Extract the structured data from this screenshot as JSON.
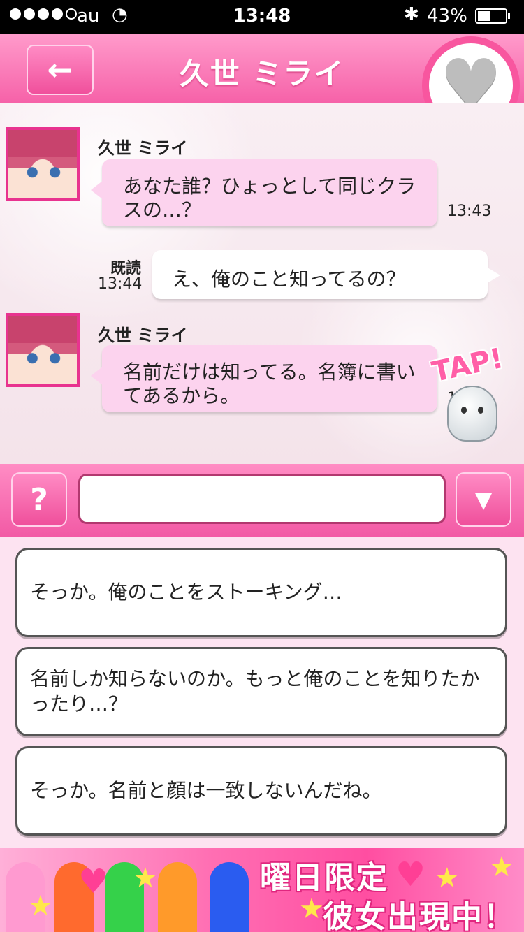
{
  "status_bar": {
    "carrier": "au",
    "time": "13:48",
    "battery_percent": "43%",
    "battery_level": 0.43,
    "signal_bars": 4
  },
  "header": {
    "back_icon": "←",
    "title": "久世 ミライ",
    "heart_icon": "♥"
  },
  "messages": [
    {
      "sender": "久世 ミライ",
      "text": "あなた誰？ひょっとして同じクラスの…？",
      "time": "13:43"
    },
    {
      "read_label": "既読",
      "text": "え、俺のこと知ってるの？",
      "time": "13:44"
    },
    {
      "sender": "久世 ミライ",
      "text": "名前だけは知ってる。名簿に書いてあるから。",
      "time": "13"
    }
  ],
  "tap_label": "TAP!",
  "input_bar": {
    "help_label": "?",
    "input_value": "",
    "dropdown_icon": "▼"
  },
  "choices": [
    "そっか。俺のことをストーキング…",
    "名前しか知らないのか。もっと俺のことを知りたかったり…？",
    "そっか。名前と顔は一致しないんだね。"
  ],
  "banner": {
    "line1": "曜日限定",
    "line2": "彼女出現中！"
  },
  "colors": {
    "accent": "#f661a8",
    "bubble_in": "#fcd3ee",
    "bubble_out": "#ffffff"
  }
}
